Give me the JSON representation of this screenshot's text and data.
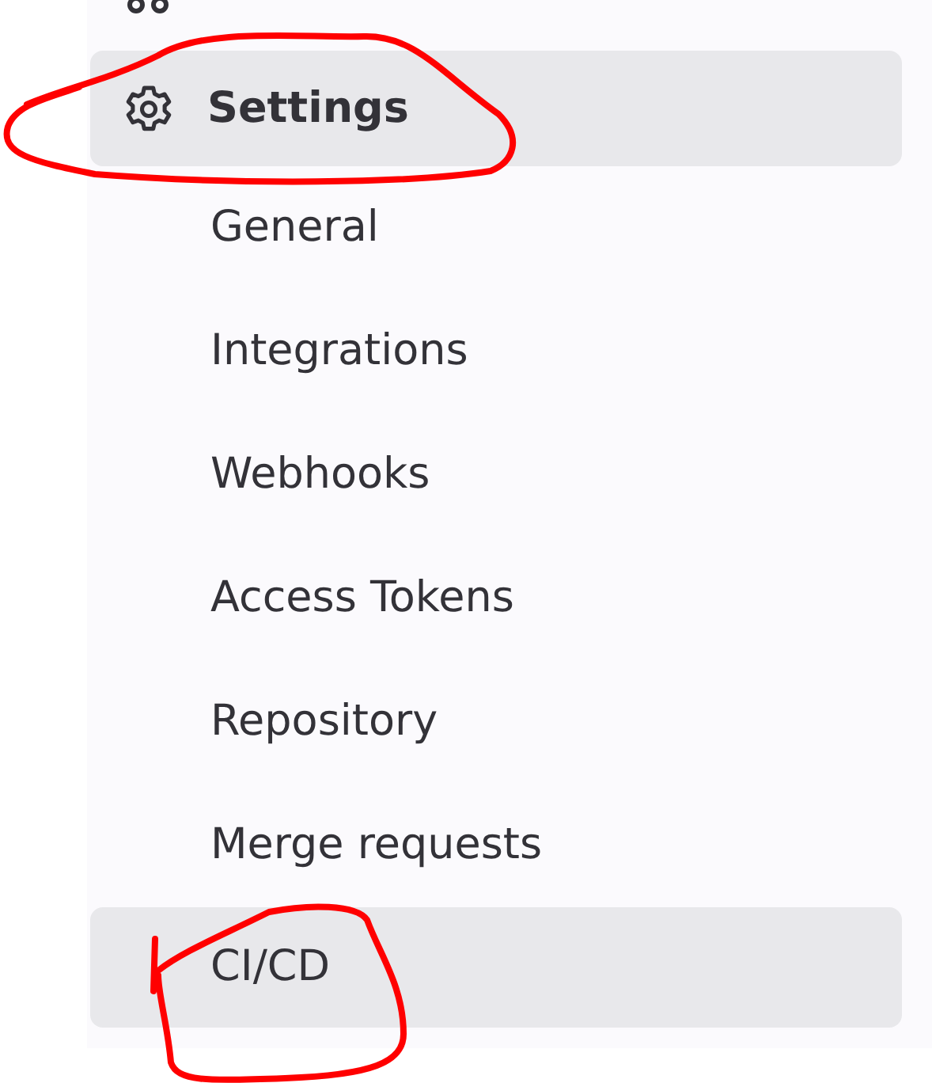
{
  "sidebar": {
    "items": [
      {
        "label": "Settings",
        "selected": true,
        "circled": true,
        "children": [
          {
            "label": "General",
            "selected": false,
            "circled": false
          },
          {
            "label": "Integrations",
            "selected": false,
            "circled": false
          },
          {
            "label": "Webhooks",
            "selected": false,
            "circled": false
          },
          {
            "label": "Access Tokens",
            "selected": false,
            "circled": false
          },
          {
            "label": "Repository",
            "selected": false,
            "circled": false
          },
          {
            "label": "Merge requests",
            "selected": false,
            "circled": false
          },
          {
            "label": "CI/CD",
            "selected": true,
            "circled": true
          }
        ]
      }
    ]
  }
}
